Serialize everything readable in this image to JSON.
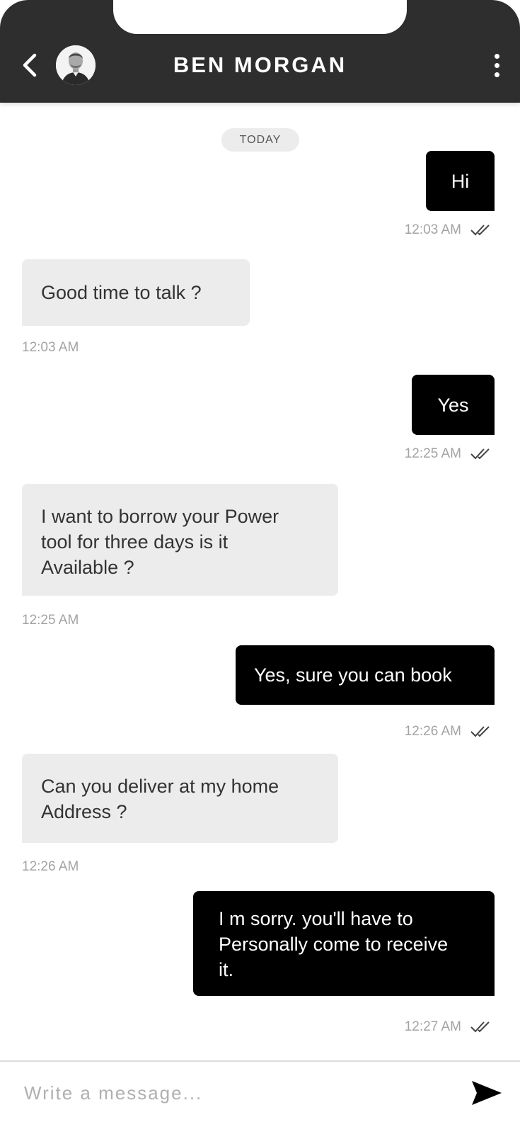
{
  "header": {
    "contact_name": "BEN MORGAN",
    "back_icon": "chevron-left-icon",
    "menu_icon": "more-vertical-icon",
    "background": "#2e2e2e"
  },
  "day_label": "TODAY",
  "messages": [
    {
      "direction": "out",
      "text": "Hi",
      "time": "12:03 AM",
      "status": "read"
    },
    {
      "direction": "in",
      "text": "Good time to talk ?",
      "time": "12:03 AM"
    },
    {
      "direction": "out",
      "text": "Yes",
      "time": "12:25 AM",
      "status": "read"
    },
    {
      "direction": "in",
      "lines": [
        "I want to borrow your Power",
        "tool for three days is it",
        "Available ?"
      ],
      "time": "12:25 AM"
    },
    {
      "direction": "out",
      "text": "Yes, sure you can book",
      "time": "12:26 AM",
      "status": "read"
    },
    {
      "direction": "in",
      "lines": [
        "Can you deliver at my home",
        "Address ?"
      ],
      "time": "12:26 AM"
    },
    {
      "direction": "out",
      "lines": [
        "I m sorry. you'll have to",
        "Personally come to receive",
        "it."
      ],
      "time": "12:27 AM",
      "status": "read"
    }
  ],
  "composer": {
    "placeholder": "Write a message...",
    "value": "",
    "send_icon": "send-icon"
  },
  "colors": {
    "outgoing_bubble": "#000000",
    "incoming_bubble": "#ececec",
    "timestamp": "#a3a3a3"
  }
}
